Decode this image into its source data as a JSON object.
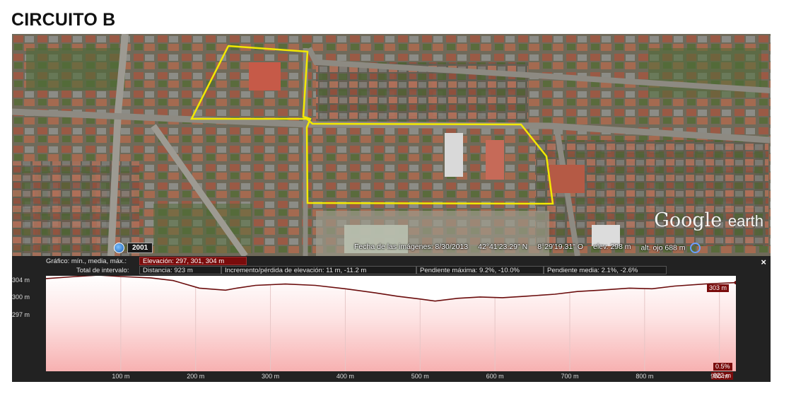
{
  "title": "CIRCUITO B",
  "map": {
    "logo_main": "Google",
    "logo_sub": "earth",
    "year": "2001",
    "image_date_label": "Fecha de las imágenes: 8/30/2013",
    "latitude": "42°41'23.29\" N",
    "longitude": "8°29'19.31\" O",
    "elevation_label": "elev.",
    "elevation_value": "298 m",
    "eye_alt_label": "alt. ojo",
    "eye_alt_value": "688 m"
  },
  "profile": {
    "graph_label": "Gráfico: mín., media, máx.:",
    "elevation_stats": "Elevación: 297, 301, 304 m",
    "interval_label": "Total de intervalo:",
    "distance": "Distancia: 923 m",
    "gain_loss": "Incremento/pérdida de elevación: 11 m, -11.2 m",
    "max_slope": "Pendiente máxima: 9.2%, -10.0%",
    "avg_slope": "Pendiente media: 2.1%, -2.6%",
    "close_symbol": "×",
    "y_ticks": [
      "304 m",
      "300 m",
      "297 m"
    ],
    "x_ticks": [
      "100 m",
      "200 m",
      "300 m",
      "400 m",
      "500 m",
      "600 m",
      "700 m",
      "800 m",
      "900 m"
    ],
    "end_elevation_tag": "303 m",
    "slope_tag": "0.5%",
    "end_distance_tag": "922 m",
    "line_color": "#6b0d0d"
  },
  "chart_data": {
    "type": "area",
    "xlabel": "",
    "ylabel": "",
    "x": [
      0,
      40,
      70,
      100,
      140,
      170,
      205,
      240,
      255,
      280,
      320,
      360,
      400,
      440,
      470,
      500,
      520,
      550,
      580,
      610,
      640,
      680,
      710,
      740,
      780,
      810,
      840,
      880,
      922
    ],
    "y": [
      303.6,
      303.9,
      304.1,
      303.9,
      303.7,
      303.3,
      302.2,
      301.9,
      302.2,
      302.6,
      302.8,
      302.6,
      302.1,
      301.5,
      301.0,
      300.6,
      300.3,
      300.7,
      300.9,
      300.8,
      301.0,
      301.3,
      301.7,
      301.9,
      302.2,
      302.1,
      302.5,
      302.8,
      303.0
    ],
    "xlim": [
      0,
      922
    ],
    "ylim": [
      290,
      304
    ]
  }
}
